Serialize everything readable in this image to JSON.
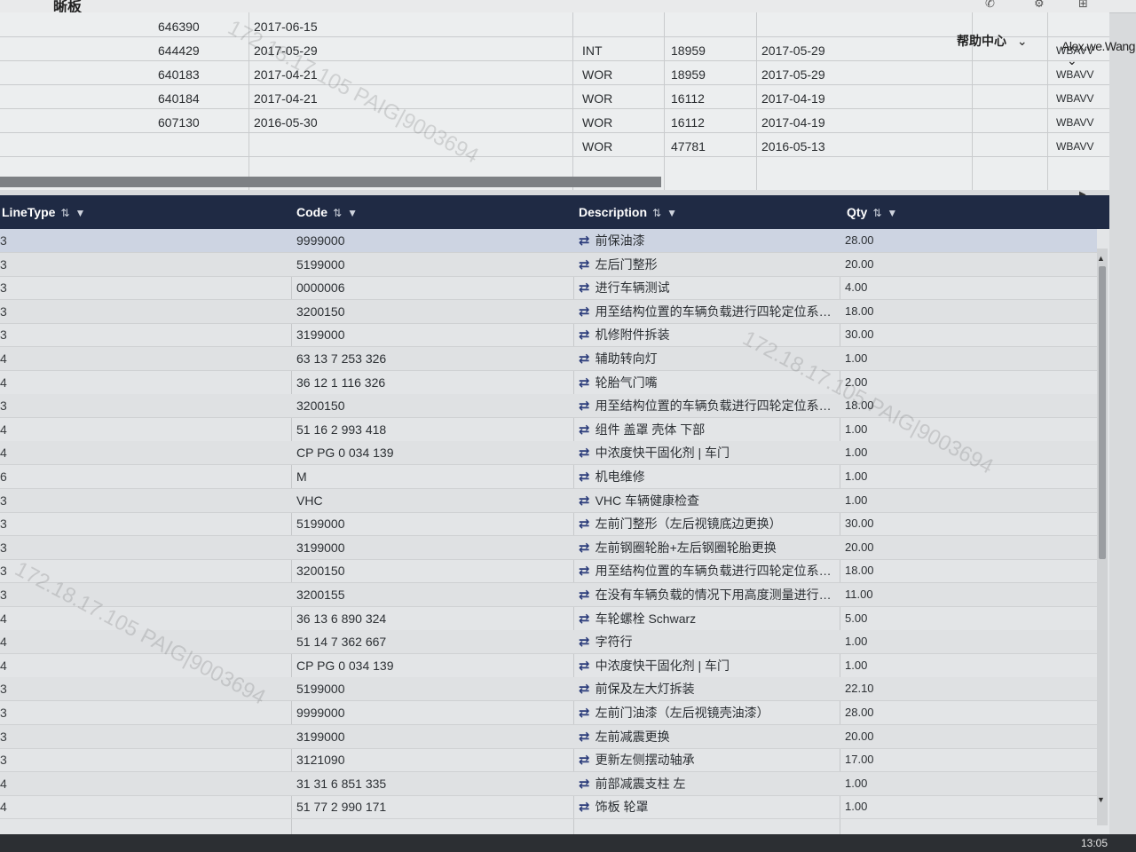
{
  "app": {
    "title": "晰板"
  },
  "header": {
    "help_label": "帮助中心",
    "help_chevron": "⌄",
    "user_name": "Alex.we.Wang",
    "user_chevron": "⌄"
  },
  "upper_table": {
    "rows": [
      {
        "no": "646390",
        "date1": "2017-06-15",
        "type": "",
        "code": "",
        "date2": "",
        "vin": ""
      },
      {
        "no": "644429",
        "date1": "2017-05-29",
        "type": "INT",
        "code": "18959",
        "date2": "2017-05-29",
        "vin": "WBAVV"
      },
      {
        "no": "640183",
        "date1": "2017-04-21",
        "type": "WOR",
        "code": "18959",
        "date2": "2017-05-29",
        "vin": "WBAVV"
      },
      {
        "no": "640184",
        "date1": "2017-04-21",
        "type": "WOR",
        "code": "16112",
        "date2": "2017-04-19",
        "vin": "WBAVV"
      },
      {
        "no": "607130",
        "date1": "2016-05-30",
        "type": "WOR",
        "code": "16112",
        "date2": "2017-04-19",
        "vin": "WBAVV"
      },
      {
        "no": "",
        "date1": "",
        "type": "WOR",
        "code": "47781",
        "date2": "2016-05-13",
        "vin": "WBAVV"
      }
    ]
  },
  "lower_table": {
    "columns": {
      "linetype": "LineType",
      "code": "Code",
      "description": "Description",
      "qty": "Qty"
    },
    "sort_icon": "⇅",
    "filter_icon": "▼",
    "swap_icon": "⇄",
    "rows": [
      {
        "linetype": "3",
        "code": "9999000",
        "description": "前保油漆",
        "qty": "28.00"
      },
      {
        "linetype": "3",
        "code": "5199000",
        "description": "左后门整形",
        "qty": "20.00"
      },
      {
        "linetype": "3",
        "code": "0000006",
        "description": "进行车辆测试",
        "qty": "4.00"
      },
      {
        "linetype": "3",
        "code": "3200150",
        "description": "用至结构位置的车辆负载进行四轮定位系统...",
        "qty": "18.00"
      },
      {
        "linetype": "3",
        "code": "3199000",
        "description": "机修附件拆装",
        "qty": "30.00"
      },
      {
        "linetype": "4",
        "code": "63 13 7 253 326",
        "description": "辅助转向灯",
        "qty": "1.00"
      },
      {
        "linetype": "4",
        "code": "36 12 1 116 326",
        "description": "轮胎气门嘴",
        "qty": "2.00"
      },
      {
        "linetype": "3",
        "code": "3200150",
        "description": "用至结构位置的车辆负载进行四轮定位系统...",
        "qty": "18.00"
      },
      {
        "linetype": "4",
        "code": "51 16 2 993 418",
        "description": "组件 盖罩 壳体 下部",
        "qty": "1.00"
      },
      {
        "linetype": "4",
        "code": "CP PG 0 034 139",
        "description": "中浓度快干固化剂 | 车门",
        "qty": "1.00"
      },
      {
        "linetype": "6",
        "code": "M",
        "description": "机电维修",
        "qty": "1.00"
      },
      {
        "linetype": "3",
        "code": "VHC",
        "description": "VHC 车辆健康检查",
        "qty": "1.00"
      },
      {
        "linetype": "3",
        "code": "5199000",
        "description": "左前门整形（左后视镜底边更换）",
        "qty": "30.00"
      },
      {
        "linetype": "3",
        "code": "3199000",
        "description": "左前钢圈轮胎+左后钢圈轮胎更换",
        "qty": "20.00"
      },
      {
        "linetype": "3",
        "code": "3200150",
        "description": "用至结构位置的车辆负载进行四轮定位系统...",
        "qty": "18.00"
      },
      {
        "linetype": "3",
        "code": "3200155",
        "description": "在没有车辆负载的情况下用高度测量进行四...",
        "qty": "11.00"
      },
      {
        "linetype": "4",
        "code": "36 13 6 890 324",
        "description": "车轮螺栓 Schwarz",
        "qty": "5.00"
      },
      {
        "linetype": "4",
        "code": "51 14 7 362 667",
        "description": "字符行",
        "qty": "1.00"
      },
      {
        "linetype": "4",
        "code": "CP PG 0 034 139",
        "description": "中浓度快干固化剂 | 车门",
        "qty": "1.00"
      },
      {
        "linetype": "3",
        "code": "5199000",
        "description": "前保及左大灯拆装",
        "qty": "22.10"
      },
      {
        "linetype": "3",
        "code": "9999000",
        "description": "左前门油漆（左后视镜壳油漆）",
        "qty": "28.00"
      },
      {
        "linetype": "3",
        "code": "3199000",
        "description": "左前减震更换",
        "qty": "20.00"
      },
      {
        "linetype": "3",
        "code": "3121090",
        "description": "更新左侧摆动轴承",
        "qty": "17.00"
      },
      {
        "linetype": "4",
        "code": "31 31 6 851 335",
        "description": "前部减震支柱 左",
        "qty": "1.00"
      },
      {
        "linetype": "4",
        "code": "51 77 2 990 171",
        "description": "饰板 轮罩",
        "qty": "1.00"
      }
    ]
  },
  "taskbar": {
    "clock": "13:05"
  },
  "watermark": {
    "text": "172.18.17.105 PAIG|9003694"
  }
}
